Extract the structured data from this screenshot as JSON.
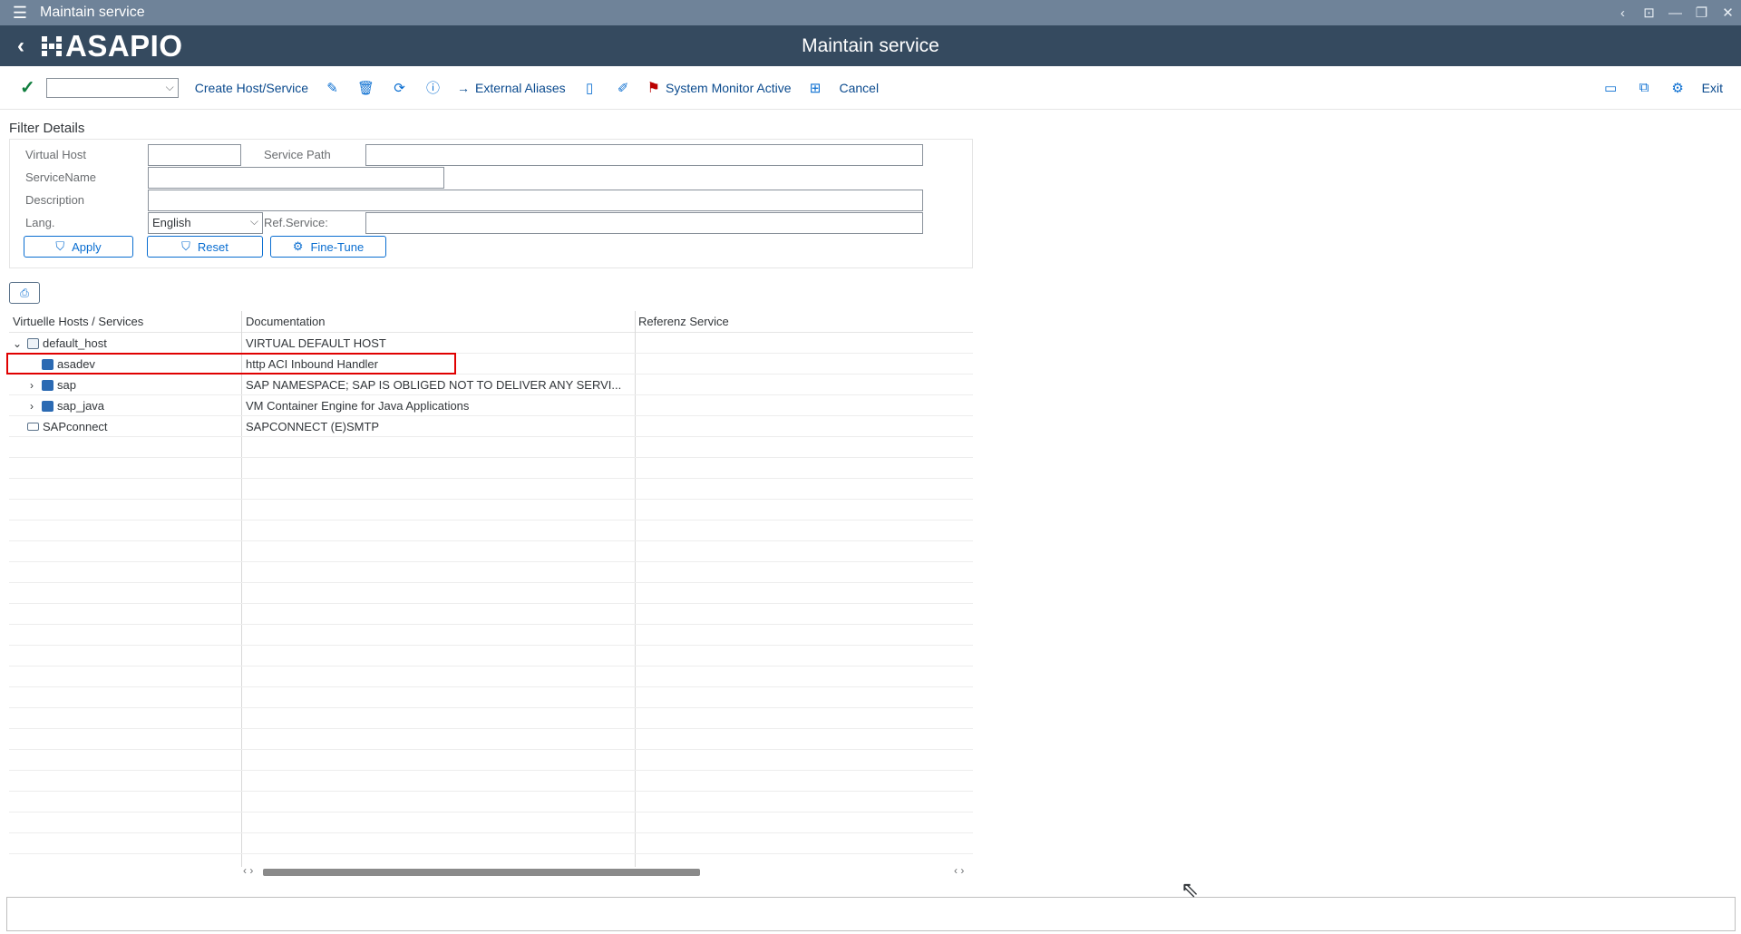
{
  "window": {
    "title": "Maintain service"
  },
  "shell": {
    "logo_text": "ASAPIO",
    "app_title": "Maintain service"
  },
  "toolbar": {
    "create_label": "Create Host/Service",
    "external_aliases_label": "External Aliases",
    "system_monitor_label": "System Monitor Active",
    "cancel_label": "Cancel",
    "exit_label": "Exit"
  },
  "filter": {
    "title": "Filter Details",
    "virtual_host_label": "Virtual Host",
    "service_path_label": "Service Path",
    "service_name_label": "ServiceName",
    "description_label": "Description",
    "lang_label": "Lang.",
    "lang_value": "English",
    "ref_service_label": "Ref.Service:",
    "apply_label": "Apply",
    "reset_label": "Reset",
    "finetune_label": "Fine-Tune"
  },
  "grid": {
    "columns": [
      "Virtuelle Hosts / Services",
      "Documentation",
      "Referenz Service"
    ],
    "rows": [
      {
        "name": "default_host",
        "doc": "VIRTUAL DEFAULT HOST",
        "ref": ""
      },
      {
        "name": "asadev",
        "doc": "http ACI Inbound Handler",
        "ref": ""
      },
      {
        "name": "sap",
        "doc": "SAP NAMESPACE; SAP IS OBLIGED NOT TO DELIVER ANY SERVI...",
        "ref": ""
      },
      {
        "name": "sap_java",
        "doc": "VM Container Engine for Java Applications",
        "ref": ""
      },
      {
        "name": "SAPconnect",
        "doc": "SAPCONNECT (E)SMTP",
        "ref": ""
      }
    ]
  }
}
